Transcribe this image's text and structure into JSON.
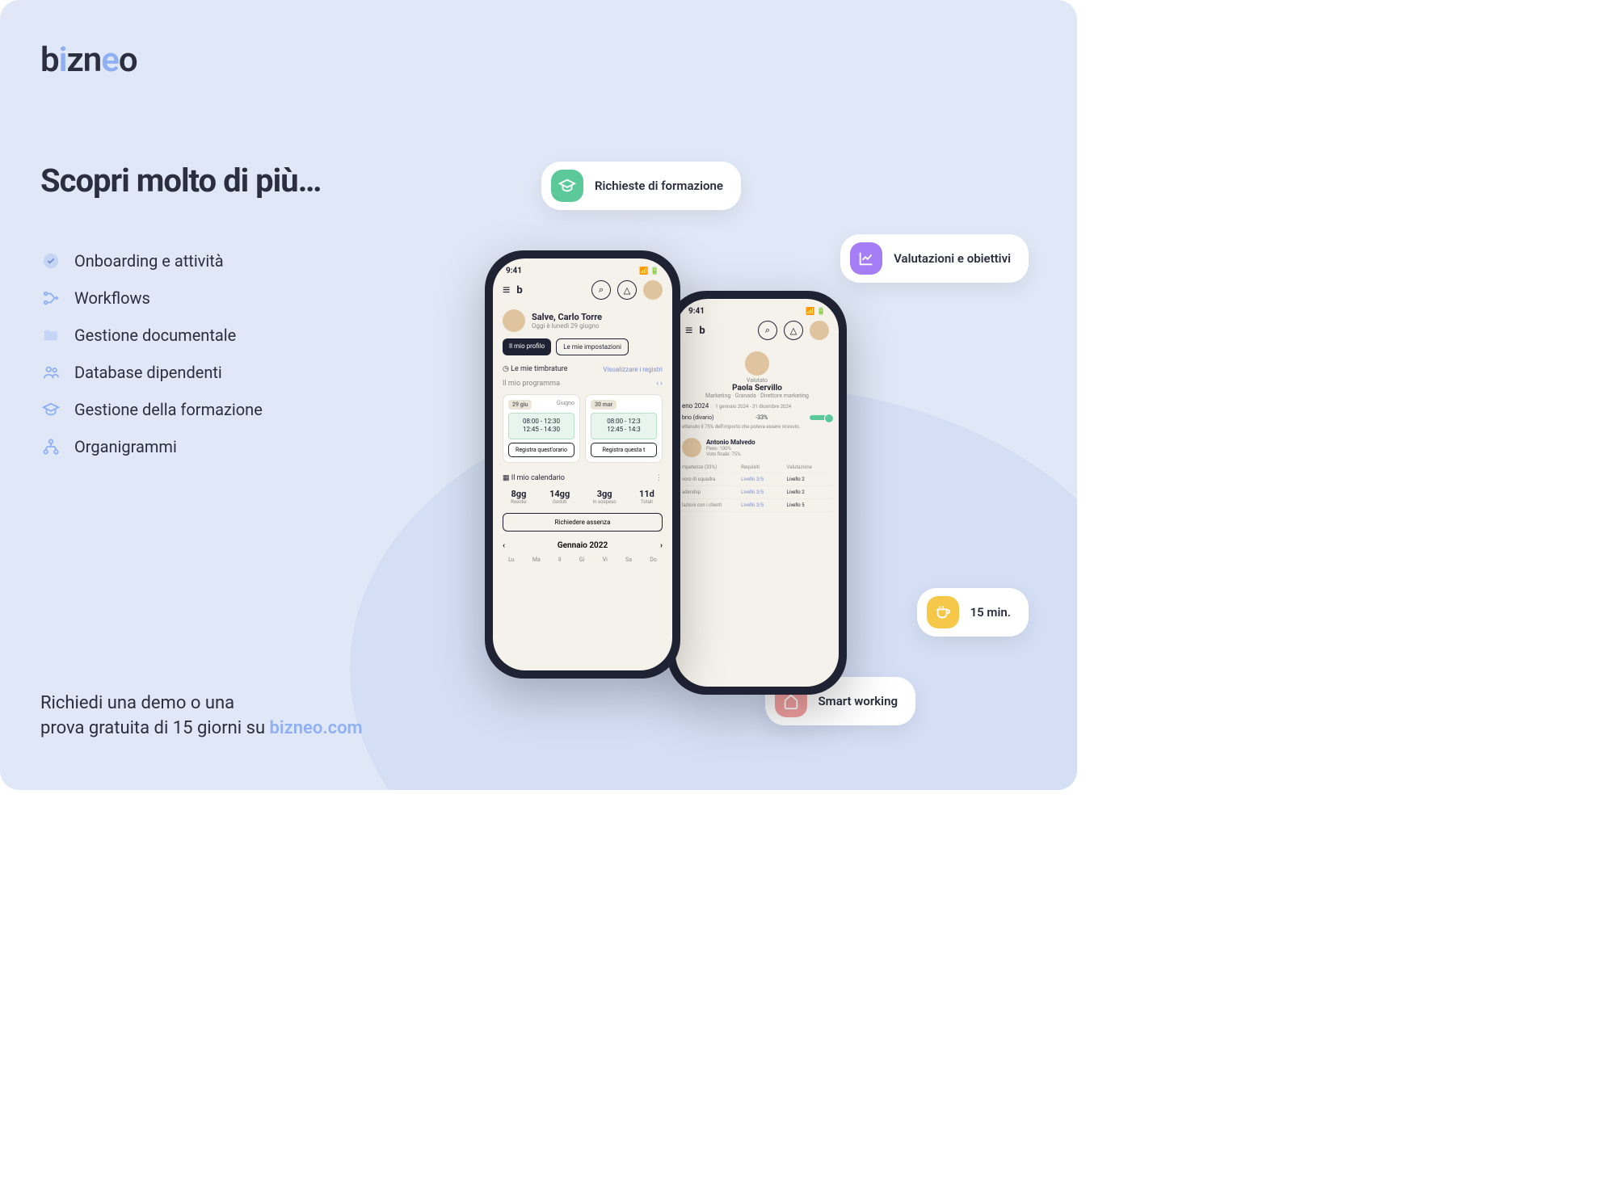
{
  "brand": "bizneo",
  "headline": "Scopri molto di più…",
  "features": [
    {
      "icon": "check-circle-icon",
      "label": "Onboarding e attività"
    },
    {
      "icon": "workflow-icon",
      "label": "Workflows"
    },
    {
      "icon": "folder-icon",
      "label": "Gestione documentale"
    },
    {
      "icon": "users-icon",
      "label": "Database dipendenti"
    },
    {
      "icon": "graduation-icon",
      "label": "Gestione della formazione"
    },
    {
      "icon": "orgchart-icon",
      "label": "Organigrammi"
    }
  ],
  "cta": {
    "line1": "Richiedi una demo o una",
    "line2_pre": "prova gratuita di 15 giorni su ",
    "link": "bizneo.com"
  },
  "pills": {
    "formazione": "Richieste di formazione",
    "valutazioni": "Valutazioni e obiettivi",
    "time": "15 min.",
    "smart": "Smart working"
  },
  "phone1": {
    "time": "9:41",
    "greeting": "Salve, Carlo Torre",
    "date": "Oggi è lunedì 29 giugno",
    "btn_profile": "Il mio profilo",
    "btn_settings": "Le mie impostazioni",
    "timbrature": "Le mie timbrature",
    "view_logs": "Visualizzare i registri",
    "programma": "Il mio programma",
    "card1": {
      "date": "29 giu",
      "month": "Giugno",
      "slot1": "08:00 - 12:30",
      "slot2": "12:45 - 14:30",
      "btn": "Registra quest'orario"
    },
    "card2": {
      "date": "30 mar",
      "month": "",
      "slot1": "08:00 - 12:3",
      "slot2": "12:45 - 14:3",
      "btn": "Registra questa t"
    },
    "calendar": "Il mio calendario",
    "stats": [
      {
        "n": "8gg",
        "l": "Residui"
      },
      {
        "n": "14gg",
        "l": "Goduti"
      },
      {
        "n": "3gg",
        "l": "In sospeso"
      },
      {
        "n": "11d",
        "l": "Totali"
      }
    ],
    "request_absence": "Richiedere assenza",
    "month": "Gennaio 2022",
    "weekdays": [
      "Lu",
      "Ma",
      "Il",
      "Gi",
      "Vi",
      "Sa",
      "Do"
    ]
  },
  "phone2": {
    "time": "9:41",
    "valutato": "Valutato",
    "name": "Paola Servillo",
    "role": "Marketing · Granada · Direttore marketing",
    "period": "eno 2024",
    "period_dates": "1 gennaio 2024 - 31 dicembre 2024",
    "divario_label": "brio (divario)",
    "divario_val": "-33%",
    "note": "ettenuto il 75% dell'importo che poteva essere ricevuto.",
    "person": {
      "name": "Antonio Malvedo",
      "peso": "Peso: 100%",
      "voto": "Voto finale: 75%."
    },
    "th": [
      "mpetenze (33%)",
      "Requisiti",
      "Valutazione"
    ],
    "rows": [
      {
        "c1": "voro di squadra",
        "c2": "Livello 3/5",
        "c3": "Livello 2"
      },
      {
        "c1": "adership",
        "c2": "Livello 3/5",
        "c3": "Livello 2"
      },
      {
        "c1": "lazioni con i clienti",
        "c2": "Livello 3/5",
        "c3": "Livello 5"
      }
    ]
  }
}
